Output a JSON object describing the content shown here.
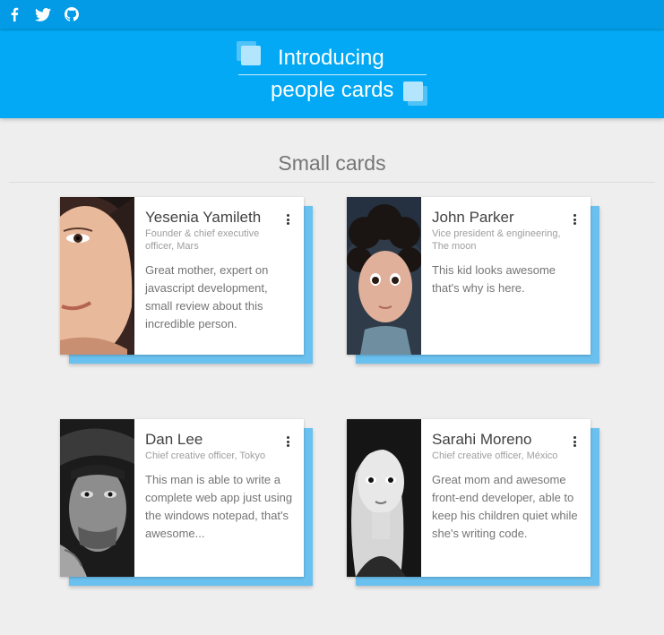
{
  "social": {
    "icons": [
      "facebook-icon",
      "twitter-icon",
      "github-icon"
    ],
    "icon_color": "#ffffff"
  },
  "header": {
    "line1": "Introducing",
    "line2": "people cards",
    "bg_color": "#03a9f4",
    "bar_color": "#039be5"
  },
  "section": {
    "title": "Small cards"
  },
  "cards": [
    {
      "name": "Yesenia Yamileth",
      "role": "Founder & chief executive officer, Mars",
      "description": "Great mother, expert on javascript development, small review about this incredible person."
    },
    {
      "name": "John Parker",
      "role": "Vice president & engineering, The moon",
      "description": "This kid looks awesome that's why is here."
    },
    {
      "name": "Dan Lee",
      "role": "Chief creative officer, Tokyo",
      "description": "This man is able to write a complete web app just using the windows notepad, that's awesome..."
    },
    {
      "name": "Sarahi Moreno",
      "role": "Chief creative officer, México",
      "description": "Great mom and awesome front-end developer, able to keep his children quiet while she's writing code."
    }
  ],
  "colors": {
    "accent_shadow": "#6ac1ef",
    "background": "#eeeeee"
  }
}
